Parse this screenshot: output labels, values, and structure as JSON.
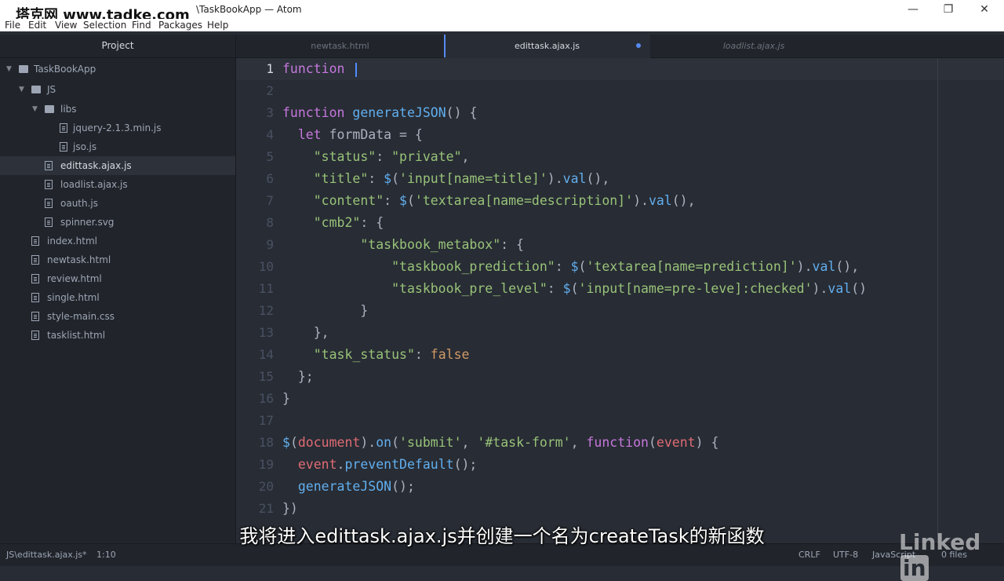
{
  "window": {
    "watermark": "塔克网 www.tadke.com",
    "title": "\\TaskBookApp — Atom",
    "minimize": "—",
    "maximize": "❐",
    "close": "✕"
  },
  "menu": [
    "File",
    "Edit",
    "View",
    "Selection",
    "Find",
    "Packages",
    "Help"
  ],
  "tree": {
    "header": "Project",
    "items": [
      {
        "label": "TaskBookApp",
        "type": "folder",
        "open": true,
        "depth": 0
      },
      {
        "label": "JS",
        "type": "folder",
        "open": true,
        "depth": 1
      },
      {
        "label": "libs",
        "type": "folder",
        "open": true,
        "depth": 2
      },
      {
        "label": "jquery-2.1.3.min.js",
        "type": "file",
        "depth": 3
      },
      {
        "label": "jso.js",
        "type": "file",
        "depth": 3
      },
      {
        "label": "edittask.ajax.js",
        "type": "file",
        "depth": 2,
        "selected": true
      },
      {
        "label": "loadlist.ajax.js",
        "type": "file",
        "depth": 2
      },
      {
        "label": "oauth.js",
        "type": "file",
        "depth": 2
      },
      {
        "label": "spinner.svg",
        "type": "file",
        "depth": 2
      },
      {
        "label": "index.html",
        "type": "file",
        "depth": 1
      },
      {
        "label": "newtask.html",
        "type": "file",
        "depth": 1
      },
      {
        "label": "review.html",
        "type": "file",
        "depth": 1
      },
      {
        "label": "single.html",
        "type": "file",
        "depth": 1
      },
      {
        "label": "style-main.css",
        "type": "file",
        "depth": 1
      },
      {
        "label": "tasklist.html",
        "type": "file",
        "depth": 1
      }
    ]
  },
  "tabs": [
    {
      "label": "newtask.html",
      "active": false
    },
    {
      "label": "edittask.ajax.js",
      "active": true,
      "modified": true
    },
    {
      "label": "loadlist.ajax.js",
      "active": false
    }
  ],
  "editor": {
    "current_line": 1,
    "lines": [
      "function ",
      "",
      "function generateJSON() {",
      "  let formData = {",
      "    \"status\": \"private\",",
      "    \"title\": $('input[name=title]').val(),",
      "    \"content\": $('textarea[name=description]').val(),",
      "    \"cmb2\": {",
      "          \"taskbook_metabox\": {",
      "              \"taskbook_prediction\": $('textarea[name=prediction]').val(),",
      "              \"taskbook_pre_level\": $('input[name=pre-leve]:checked').val()",
      "          }",
      "    },",
      "    \"task_status\": false",
      "  };",
      "}",
      "",
      "$(document).on('submit', '#task-form', function(event) {",
      "  event.preventDefault();",
      "  generateJSON();",
      "})"
    ]
  },
  "status": {
    "path": "JS\\edittask.ajax.js*",
    "position": "1:10",
    "line_ending": "CRLF",
    "encoding": "UTF-8",
    "grammar": "JavaScript",
    "files": "0 files"
  },
  "subtitle": "我将进入edittask.ajax.js并创建一个名为createTask的新函数",
  "brand": {
    "linked": "Linked",
    "in": "in"
  },
  "colors": {
    "accent": "#568af2",
    "keyword": "#c678dd",
    "function": "#61afef",
    "string": "#98c379",
    "variable": "#e06c75",
    "boolean": "#d19a66"
  }
}
